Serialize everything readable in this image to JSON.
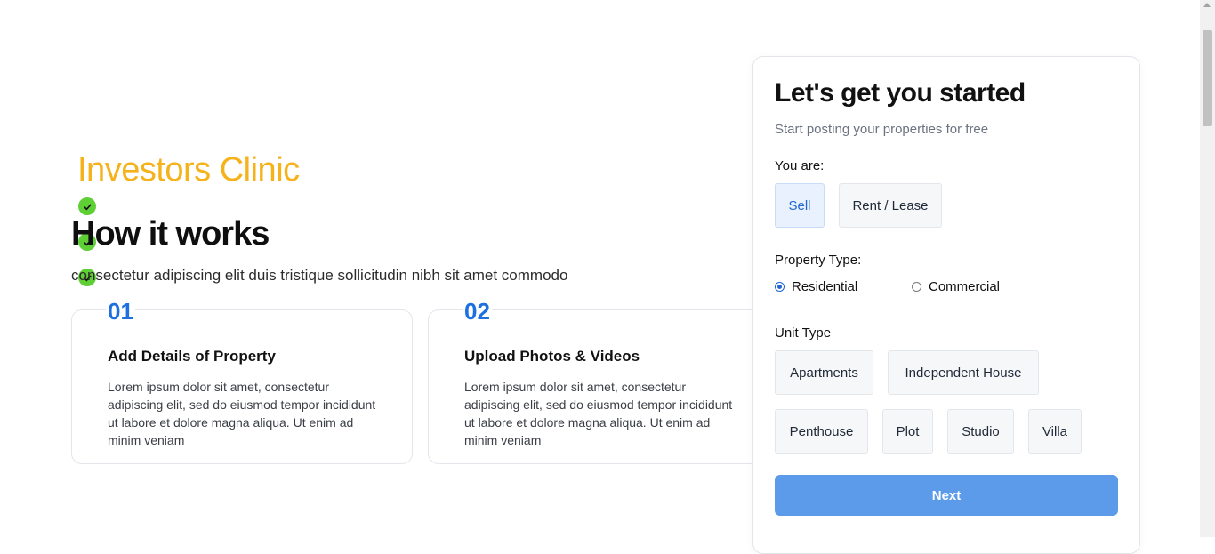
{
  "brand": {
    "name": "Investors Clinic"
  },
  "hero": {
    "title": "How it works",
    "subtitle": "consectetur adipiscing elit duis tristique sollicitudin nibh sit amet commodo"
  },
  "steps": [
    {
      "number": "01",
      "title": "Add Details of Property",
      "description": "Lorem ipsum dolor sit amet, consectetur adipiscing elit, sed do eiusmod tempor incididunt ut labore et dolore magna aliqua. Ut enim ad minim veniam"
    },
    {
      "number": "02",
      "title": "Upload Photos & Videos",
      "description": "Lorem ipsum dolor sit amet, consectetur adipiscing elit, sed do eiusmod tempor incididunt ut labore et dolore magna aliqua. Ut enim ad minim veniam"
    }
  ],
  "form": {
    "title": "Let's get you started",
    "subtitle": "Start posting your properties for free",
    "you_are_label": "You are:",
    "you_are_options": [
      "Sell",
      "Rent / Lease"
    ],
    "you_are_selected": "Sell",
    "property_type_label": "Property Type:",
    "property_type_options": [
      "Residential",
      "Commercial"
    ],
    "property_type_selected": "Residential",
    "unit_type_label": "Unit Type",
    "unit_type_options": [
      "Apartments",
      "Independent House",
      "Penthouse",
      "Plot",
      "Studio",
      "Villa"
    ],
    "next_label": "Next"
  },
  "icons": {
    "check": "check-circle-icon",
    "radio_selected": "radio-selected-icon",
    "radio_unselected": "radio-unselected-icon"
  },
  "colors": {
    "brand_yellow": "#f5b21b",
    "accent_blue": "#1e6fe0",
    "check_green": "#5fcf36",
    "button_blue": "#5b9bea",
    "selected_chip_bg": "#e8f1fd"
  }
}
